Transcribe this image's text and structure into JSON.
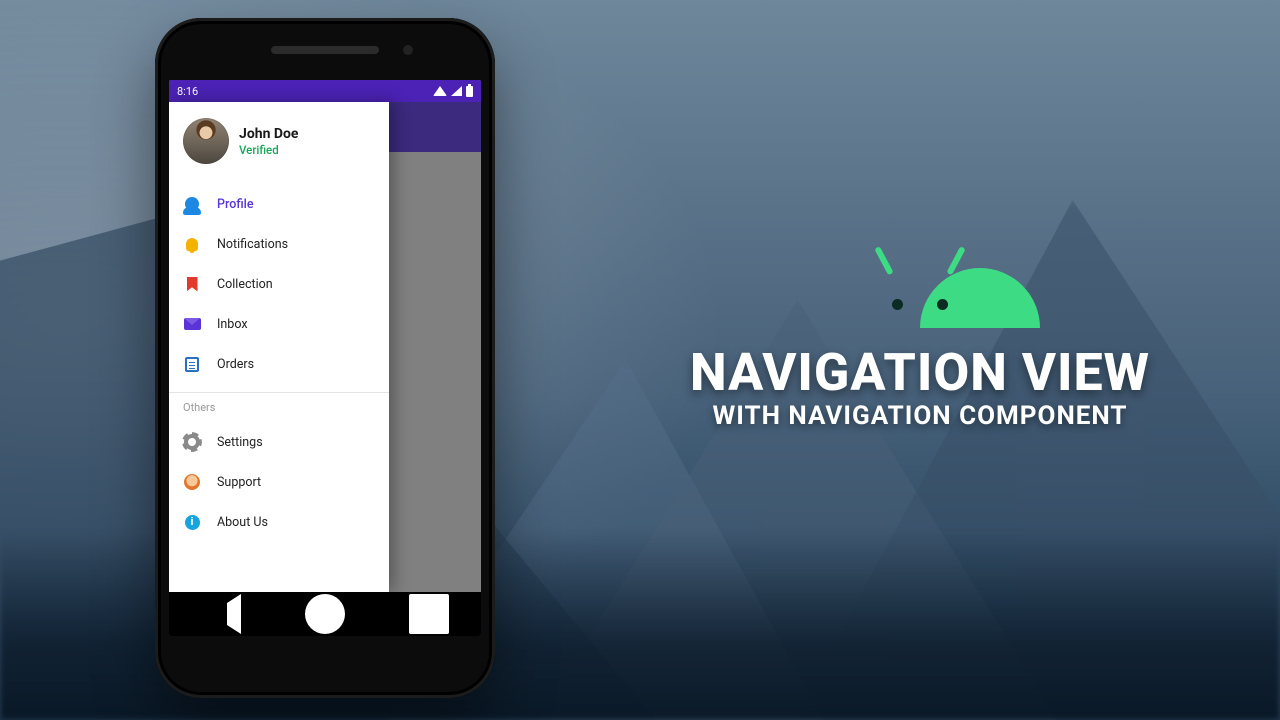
{
  "background": {
    "desc": "blurred mountain forest"
  },
  "hero": {
    "title": "NAVIGATION VIEW",
    "subtitle": "WITH NAVIGATION COMPONENT"
  },
  "status": {
    "time": "8:16"
  },
  "drawer": {
    "user": {
      "name": "John Doe",
      "status": "Verified"
    },
    "section_label": "Others",
    "items_primary": [
      {
        "label": "Profile",
        "icon": "person-icon",
        "active": true
      },
      {
        "label": "Notifications",
        "icon": "bell-icon",
        "active": false
      },
      {
        "label": "Collection",
        "icon": "bookmark-icon",
        "active": false
      },
      {
        "label": "Inbox",
        "icon": "mail-icon",
        "active": false
      },
      {
        "label": "Orders",
        "icon": "orders-icon",
        "active": false
      }
    ],
    "items_secondary": [
      {
        "label": "Settings",
        "icon": "gear-icon"
      },
      {
        "label": "Support",
        "icon": "support-icon"
      },
      {
        "label": "About Us",
        "icon": "info-icon"
      }
    ]
  },
  "colors": {
    "statusbar": "#4b22b5",
    "appbar": "#3b2a7e",
    "accent": "#5a34d6",
    "verified": "#18a558",
    "android": "#3ddc84"
  }
}
